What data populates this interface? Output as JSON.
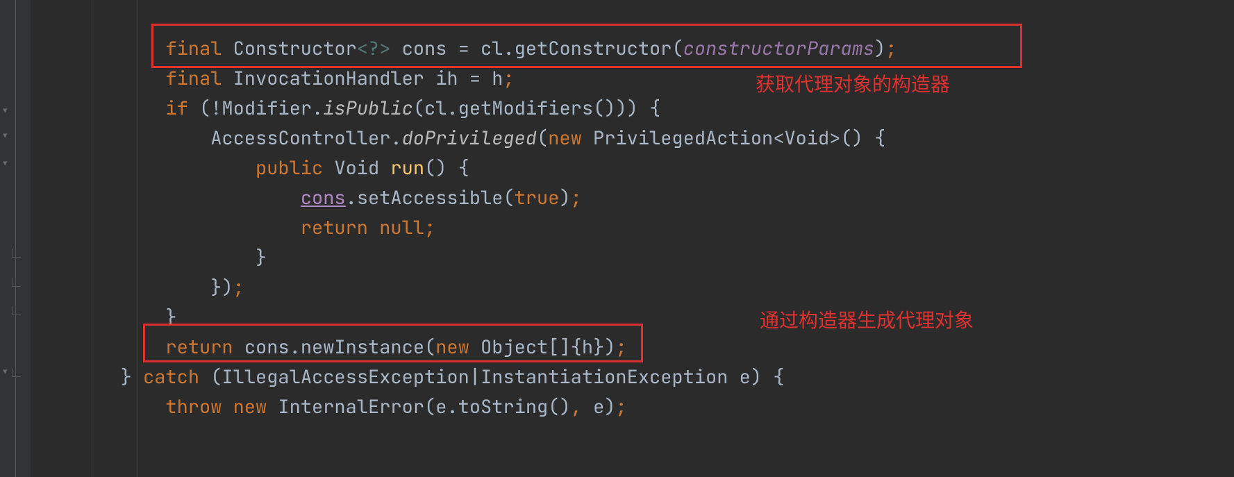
{
  "code": {
    "line1": {
      "kw_final": "final",
      "type": "Constructor",
      "generic": "<?>",
      "var": "cons",
      "eq": "=",
      "obj": "cl",
      "dot1": ".",
      "method": "getConstructor",
      "lp": "(",
      "param": "constructorParams",
      "rp": ")",
      "sem": ";"
    },
    "line2": {
      "kw_final": "final",
      "type": "InvocationHandler",
      "var": "ih",
      "eq": "=",
      "rhs": "h",
      "sem": ";"
    },
    "line3": {
      "kw_if": "if",
      "lp": "(",
      "neg": "!",
      "cls": "Modifier",
      "dot1": ".",
      "m_isPublic": "isPublic",
      "lp2": "(",
      "obj": "cl",
      "dot2": ".",
      "m_getMod": "getModifiers",
      "lp3": "()",
      "rp2": ")",
      "rp": ")",
      "brace": "{"
    },
    "line4": {
      "cls": "AccessController",
      "dot1": ".",
      "m_do": "doPrivileged",
      "lp": "(",
      "kw_new": "new",
      "type": "PrivilegedAction",
      "gen_open": "<",
      "gen_t": "Void",
      "gen_close": ">",
      "paren": "()",
      "brace": "{"
    },
    "line5": {
      "kw_public": "public",
      "ret": "Void",
      "name": "run",
      "paren": "()",
      "brace": "{"
    },
    "line6": {
      "var": "cons",
      "dot": ".",
      "method": "setAccessible",
      "lp": "(",
      "arg": "true",
      "rp": ")",
      "sem": ";"
    },
    "line7": {
      "kw_return": "return",
      "val": "null",
      "sem": ";"
    },
    "line8": {
      "brace": "}"
    },
    "line9": {
      "brace": "}",
      "rp": ")",
      "sem": ";"
    },
    "line10": {
      "brace": "}"
    },
    "line11": {
      "kw_return": "return",
      "obj": "cons",
      "dot": ".",
      "method": "newInstance",
      "lp": "(",
      "kw_new": "new",
      "type": "Object",
      "brk": "[]",
      "lb": "{",
      "arg": "h",
      "rb": "}",
      "rp": ")",
      "sem": ";"
    },
    "line12": {
      "brace1": "}",
      "kw_catch": "catch",
      "lp": "(",
      "ex1": "IllegalAccessException",
      "pipe": "|",
      "ex2": "InstantiationException",
      "var": "e",
      "rp": ")",
      "brace2": "{"
    },
    "line13": {
      "kw_throw": "throw",
      "kw_new": "new",
      "type": "InternalError",
      "lp": "(",
      "obj": "e",
      "dot": ".",
      "method": "toString",
      "paren": "()",
      "comma": ",",
      "arg2": "e",
      "rp": ")",
      "sem": ";"
    }
  },
  "annotations": {
    "top": "获取代理对象的构造器",
    "bottom": "通过构造器生成代理对象"
  }
}
